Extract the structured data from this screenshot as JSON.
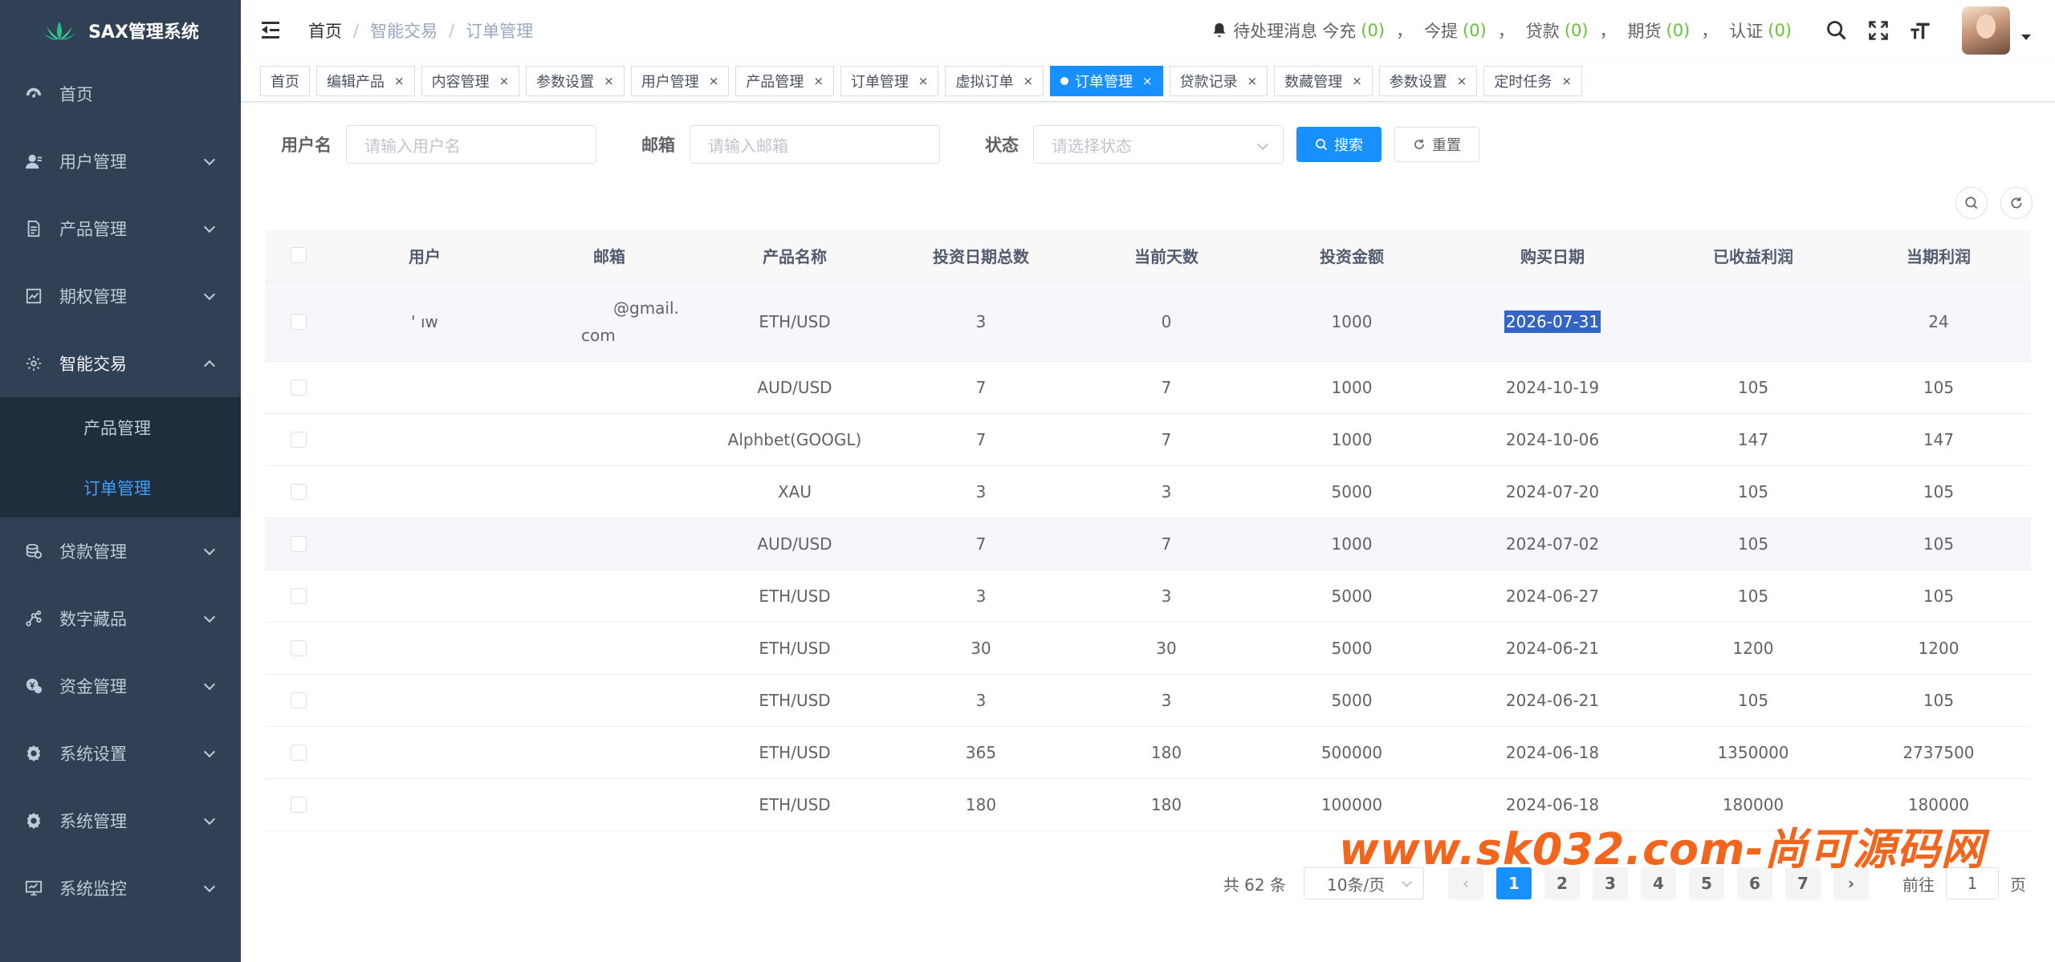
{
  "app": {
    "title": "SAX管理系统"
  },
  "sidebar": {
    "items": [
      {
        "label": "首页",
        "icon": "dashboard-icon"
      },
      {
        "label": "用户管理",
        "icon": "user-icon"
      },
      {
        "label": "产品管理",
        "icon": "document-icon"
      },
      {
        "label": "期权管理",
        "icon": "chart-icon"
      },
      {
        "label": "智能交易",
        "icon": "gear-icon"
      },
      {
        "label": "贷款管理",
        "icon": "coins-icon"
      },
      {
        "label": "数字藏品",
        "icon": "nodes-icon"
      },
      {
        "label": "资金管理",
        "icon": "money-icon"
      },
      {
        "label": "系统设置",
        "icon": "settings-icon"
      },
      {
        "label": "系统管理",
        "icon": "settings-icon"
      },
      {
        "label": "系统监控",
        "icon": "monitor-icon"
      }
    ],
    "submenu": [
      {
        "label": "产品管理"
      },
      {
        "label": "订单管理"
      }
    ]
  },
  "header": {
    "breadcrumb": [
      "首页",
      "智能交易",
      "订单管理"
    ],
    "notify": {
      "label": "待处理消息",
      "items": [
        {
          "label": "今充",
          "count": "(0)"
        },
        {
          "label": "今提",
          "count": "(0)"
        },
        {
          "label": "贷款",
          "count": "(0)"
        },
        {
          "label": "期货",
          "count": "(0)"
        },
        {
          "label": "认证",
          "count": "(0)"
        }
      ],
      "sep": "，"
    }
  },
  "tags": [
    {
      "label": "首页",
      "closable": false
    },
    {
      "label": "编辑产品",
      "closable": true
    },
    {
      "label": "内容管理",
      "closable": true
    },
    {
      "label": "参数设置",
      "closable": true
    },
    {
      "label": "用户管理",
      "closable": true
    },
    {
      "label": "产品管理",
      "closable": true
    },
    {
      "label": "订单管理",
      "closable": true
    },
    {
      "label": "虚拟订单",
      "closable": true
    },
    {
      "label": "订单管理",
      "closable": true,
      "active": true
    },
    {
      "label": "贷款记录",
      "closable": true
    },
    {
      "label": "数藏管理",
      "closable": true
    },
    {
      "label": "参数设置",
      "closable": true
    },
    {
      "label": "定时任务",
      "closable": true
    }
  ],
  "close_glyph": "×",
  "search": {
    "username_label": "用户名",
    "username_placeholder": "请输入用户名",
    "email_label": "邮箱",
    "email_placeholder": "请输入邮箱",
    "status_label": "状态",
    "status_placeholder": "请选择状态",
    "search_btn": "搜索",
    "reset_btn": "重置"
  },
  "table": {
    "headers": [
      "用户",
      "邮箱",
      "产品名称",
      "投资日期总数",
      "当前天数",
      "投资金额",
      "购买日期",
      "已收益利润",
      "当期利润"
    ],
    "rows": [
      {
        "user": "'          ıw",
        "email_1": "@gmail.",
        "email_2": "com",
        "product": "ETH/USD",
        "total": "3",
        "days": "0",
        "amount": "1000",
        "date": "2026-07-31",
        "earned": "",
        "profit": "24"
      },
      {
        "user": "",
        "email_1": "",
        "email_2": "",
        "product": "AUD/USD",
        "total": "7",
        "days": "7",
        "amount": "1000",
        "date": "2024-10-19",
        "earned": "105",
        "profit": "105"
      },
      {
        "user": "",
        "email_1": "",
        "email_2": "",
        "product": "Alphbet(GOOGL)",
        "total": "7",
        "days": "7",
        "amount": "1000",
        "date": "2024-10-06",
        "earned": "147",
        "profit": "147"
      },
      {
        "user": "",
        "email_1": "",
        "email_2": "",
        "product": "XAU",
        "total": "3",
        "days": "3",
        "amount": "5000",
        "date": "2024-07-20",
        "earned": "105",
        "profit": "105"
      },
      {
        "user": "",
        "email_1": "",
        "email_2": "",
        "product": "AUD/USD",
        "total": "7",
        "days": "7",
        "amount": "1000",
        "date": "2024-07-02",
        "earned": "105",
        "profit": "105"
      },
      {
        "user": "",
        "email_1": "",
        "email_2": "",
        "product": "ETH/USD",
        "total": "3",
        "days": "3",
        "amount": "5000",
        "date": "2024-06-27",
        "earned": "105",
        "profit": "105"
      },
      {
        "user": "",
        "email_1": "",
        "email_2": "",
        "product": "ETH/USD",
        "total": "30",
        "days": "30",
        "amount": "5000",
        "date": "2024-06-21",
        "earned": "1200",
        "profit": "1200"
      },
      {
        "user": "",
        "email_1": "",
        "email_2": "",
        "product": "ETH/USD",
        "total": "3",
        "days": "3",
        "amount": "5000",
        "date": "2024-06-21",
        "earned": "105",
        "profit": "105"
      },
      {
        "user": "",
        "email_1": "",
        "email_2": "",
        "product": "ETH/USD",
        "total": "365",
        "days": "180",
        "amount": "500000",
        "date": "2024-06-18",
        "earned": "1350000",
        "profit": "2737500"
      },
      {
        "user": "",
        "email_1": "",
        "email_2": "",
        "product": "ETH/USD",
        "total": "180",
        "days": "180",
        "amount": "100000",
        "date": "2024-06-18",
        "earned": "180000",
        "profit": "180000"
      }
    ]
  },
  "pagination": {
    "total": "共 62 条",
    "page_size": "10条/页",
    "pages": [
      "1",
      "2",
      "3",
      "4",
      "5",
      "6",
      "7"
    ],
    "current": "1",
    "goto_label": "前往",
    "goto_value": "1",
    "goto_suffix": "页"
  },
  "watermark": "www.sk032.com-尚可源码网",
  "colors": {
    "sidebar": "#304156",
    "submenu": "#1f2d3d",
    "accent": "#1890ff",
    "green": "#67c23a",
    "watermark": "#f2651d"
  }
}
